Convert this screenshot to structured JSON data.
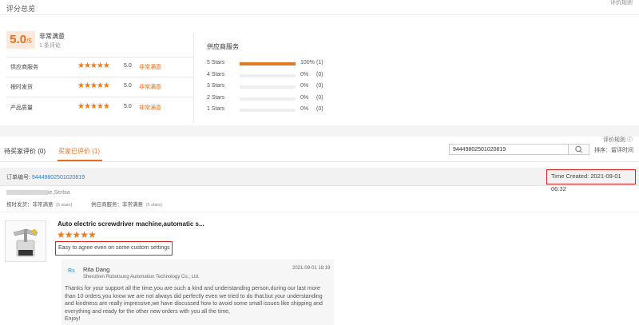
{
  "header": {
    "title": "评分总览",
    "top_right": "评价规则"
  },
  "summary": {
    "score": "5.0",
    "score_suffix": "/5",
    "label": "非常满意",
    "count": "1 条评论",
    "rows": [
      {
        "label": "供应商服务",
        "stars": 5,
        "value": "5.0",
        "tag": "非常满意"
      },
      {
        "label": "按时发货",
        "stars": 5,
        "value": "5.0",
        "tag": "非常满意"
      },
      {
        "label": "产品质量",
        "stars": 5,
        "value": "5.0",
        "tag": "非常满意"
      }
    ]
  },
  "supplier": {
    "title": "供应商服务",
    "dist": [
      {
        "label": "5 Stars",
        "pct": "100%",
        "count": "(1)",
        "fraction": 1.0
      },
      {
        "label": "4 Stars",
        "pct": "0%",
        "count": "(0)",
        "fraction": 0
      },
      {
        "label": "3 Stars",
        "pct": "0%",
        "count": "(0)",
        "fraction": 0
      },
      {
        "label": "2 Stars",
        "pct": "0%",
        "count": "(0)",
        "fraction": 0
      },
      {
        "label": "1 Stars",
        "pct": "0%",
        "count": "(0)",
        "fraction": 0
      }
    ]
  },
  "tabs": {
    "rule_link": "评价规则 ⓘ",
    "pending": "待买家评价 (0)",
    "reviewed": "买家已评价 (1)"
  },
  "search": {
    "value": "94449802501020819"
  },
  "sort": {
    "label": "排序：留评时间"
  },
  "order": {
    "label": "订单编号:",
    "number": "94449802501020819",
    "time_created": "Time Created:  2021-09-01 06:32"
  },
  "buyer": {
    "country_suffix": "ie,Serbia",
    "ratings": [
      {
        "name": "按时发货：",
        "tag": "非常满意",
        "stars": "(5 stars)"
      },
      {
        "name": "供应商服务：",
        "tag": "非常满意",
        "stars": "(5 stars)"
      }
    ]
  },
  "product": {
    "title": "Auto electric screwdriver machine,automatic s...",
    "stars": 5,
    "review": "Easy to agree even on some custom settings"
  },
  "reply": {
    "name": "Rita Dang",
    "company": "Shenzhen Robotsung Automation Technology Co., Ltd.",
    "time": "2021-09-01 18:19",
    "lines": [
      "Thanks for your support all the time,you are such a kind and understanding person,during our last more",
      "than 10 orders,you know we are not always did perfectly even we tried to do that,but your understanding",
      "and kindness are really impressive,we have discussed how to avoid some small issues like shipping and",
      "everything and ready for the other new orders with you all the time,",
      "Enjoy!"
    ]
  },
  "colors": {
    "accent": "#e67020",
    "link": "#2a7fd4",
    "highlight_border": "#d22222"
  }
}
